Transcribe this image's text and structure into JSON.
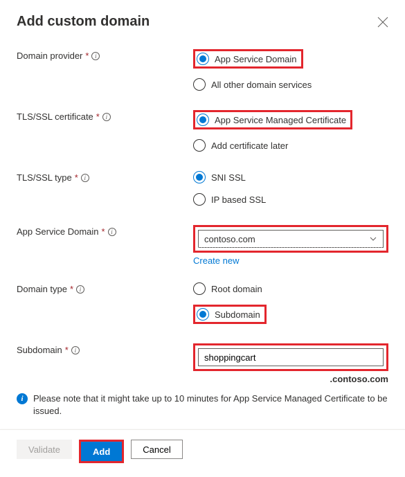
{
  "header": {
    "title": "Add custom domain"
  },
  "fields": {
    "domainProvider": {
      "label": "Domain provider",
      "opt1": "App Service Domain",
      "opt2": "All other domain services"
    },
    "tlsCert": {
      "label": "TLS/SSL certificate",
      "opt1": "App Service Managed Certificate",
      "opt2": "Add certificate later"
    },
    "tlsType": {
      "label": "TLS/SSL type",
      "opt1": "SNI SSL",
      "opt2": "IP based SSL"
    },
    "appServiceDomain": {
      "label": "App Service Domain",
      "value": "contoso.com",
      "createNew": "Create new"
    },
    "domainType": {
      "label": "Domain type",
      "opt1": "Root domain",
      "opt2": "Subdomain"
    },
    "subdomain": {
      "label": "Subdomain",
      "value": "shoppingcart",
      "suffix": ".contoso.com"
    }
  },
  "note": "Please note that it might take up to 10 minutes for App Service Managed Certificate to be issued.",
  "buttons": {
    "validate": "Validate",
    "add": "Add",
    "cancel": "Cancel"
  }
}
